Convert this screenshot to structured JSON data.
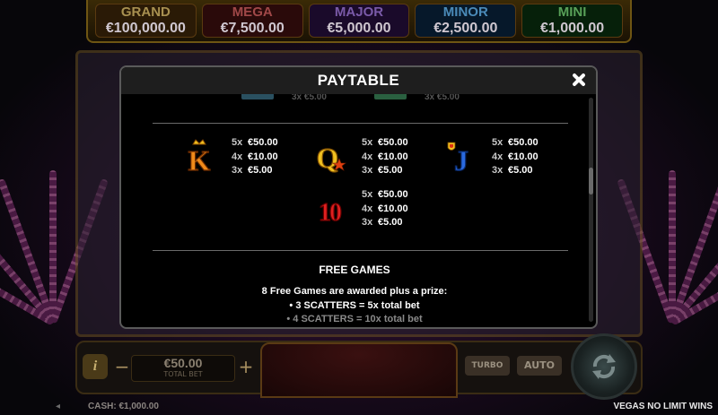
{
  "jackpots": [
    {
      "name": "GRAND",
      "value": "€100,000.00"
    },
    {
      "name": "MEGA",
      "value": "€7,500.00"
    },
    {
      "name": "MAJOR",
      "value": "€5,000.00"
    },
    {
      "name": "MINOR",
      "value": "€2,500.00"
    },
    {
      "name": "MINI",
      "value": "€1,000.00"
    }
  ],
  "controls": {
    "bet_value": "€50.00",
    "bet_label": "TOTAL BET",
    "turbo_label": "TURBO",
    "auto_label": "AUTO",
    "cash_text": "CASH: €1,000.00",
    "brand_text": "VEGAS NO LIMIT WINS"
  },
  "paytable": {
    "title": "PAYTABLE",
    "prev_row_pays": [
      "3x €5.00",
      "3x €5.00"
    ],
    "symbols": [
      {
        "icon": "king-card-icon",
        "glyph": "K",
        "color": "#f08a1a",
        "pays": [
          {
            "mult": "5x",
            "amount": "€50.00"
          },
          {
            "mult": "4x",
            "amount": "€10.00"
          },
          {
            "mult": "3x",
            "amount": "€5.00"
          }
        ]
      },
      {
        "icon": "queen-card-icon",
        "glyph": "Q",
        "color": "#f0c020",
        "pays": [
          {
            "mult": "5x",
            "amount": "€50.00"
          },
          {
            "mult": "4x",
            "amount": "€10.00"
          },
          {
            "mult": "3x",
            "amount": "€5.00"
          }
        ]
      },
      {
        "icon": "jack-card-icon",
        "glyph": "J",
        "color": "#2a6ae0",
        "pays": [
          {
            "mult": "5x",
            "amount": "€50.00"
          },
          {
            "mult": "4x",
            "amount": "€10.00"
          },
          {
            "mult": "3x",
            "amount": "€5.00"
          }
        ]
      },
      {
        "icon": "ten-card-icon",
        "glyph": "10",
        "color": "#e02020",
        "pays": [
          {
            "mult": "5x",
            "amount": "€50.00"
          },
          {
            "mult": "4x",
            "amount": "€10.00"
          },
          {
            "mult": "3x",
            "amount": "€5.00"
          }
        ]
      }
    ],
    "free_games": {
      "title": "FREE GAMES",
      "description": "8 Free Games are awarded plus a prize:",
      "bullets": [
        "• 3 SCATTERS = 5x total bet",
        "• 4 SCATTERS = 10x total bet"
      ]
    }
  }
}
